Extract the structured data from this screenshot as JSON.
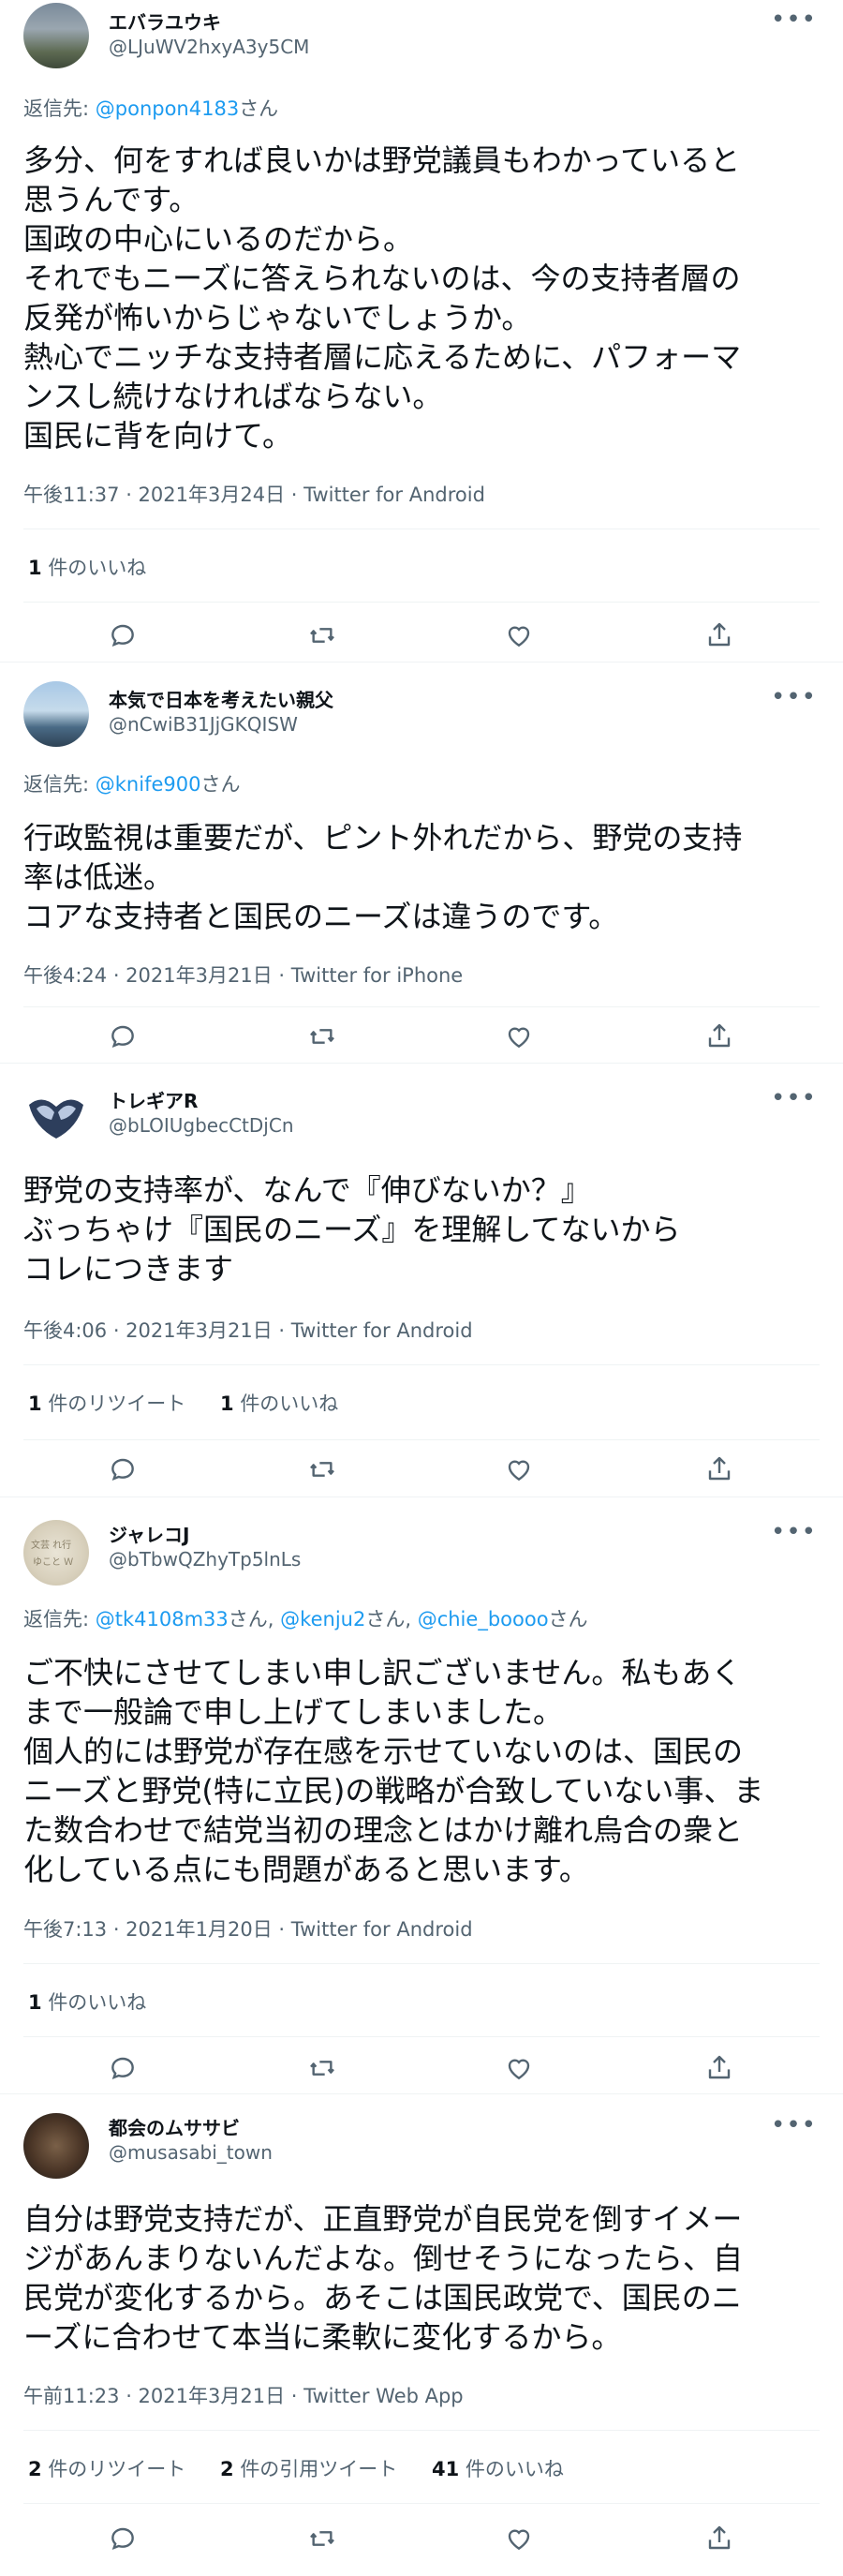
{
  "tweets": [
    {
      "name": "エバラユウキ",
      "handle": "@LJuWV2hxyA3y5CM",
      "reply_label": "返信先:",
      "reply_to": "@ponpon4183",
      "reply_suffix": "さん",
      "lines": [
        "多分、何をすれば良いかは野党議員もわかっていると",
        "思うんです。",
        "国政の中心にいるのだから。",
        "それでもニーズに答えられないのは、今の支持者層の",
        "反発が怖いからじゃないでしょうか。",
        "熱心でニッチな支持者層に応えるために、パフォーマ",
        "ンスし続けなければならない。",
        "国民に背を向けて。"
      ],
      "meta": "午後11:37 · 2021年3月24日 · Twitter for Android",
      "stats": [
        {
          "count": "1",
          "label": "件のいいね"
        }
      ]
    },
    {
      "name": "本気で日本を考えたい親父",
      "handle": "@nCwiB31JjGKQISW",
      "reply_label": "返信先:",
      "reply_to": "@knife900",
      "reply_suffix": "さん",
      "lines": [
        "行政監視は重要だが、ピント外れだから、野党の支持",
        "率は低迷。",
        "コアな支持者と国民のニーズは違うのです。"
      ],
      "meta": "午後4:24 · 2021年3月21日 · Twitter for iPhone",
      "stats": []
    },
    {
      "name": "トレギアR",
      "handle": "@bLOIUgbecCtDjCn",
      "lines": [
        "野党の支持率が、なんで『伸びないか？』",
        "ぶっちゃけ『国民のニーズ』を理解してないから",
        "コレにつきます"
      ],
      "meta": "午後4:06 · 2021年3月21日 · Twitter for Android",
      "stats": [
        {
          "count": "1",
          "label": "件のリツイート"
        },
        {
          "count": "1",
          "label": "件のいいね"
        }
      ]
    },
    {
      "name": "ジャレコJ",
      "handle": "@bTbwQZhyTp5lnLs",
      "reply_label": "返信先:",
      "reply_to_multi": [
        "@tk4108m33",
        "@kenju2",
        "@chie_boooo"
      ],
      "reply_sep": "さん,",
      "reply_suffix": "さん",
      "lines": [
        "ご不快にさせてしまい申し訳ございません。私もあく",
        "まで一般論で申し上げてしまいました。",
        "個人的には野党が存在感を示せていないのは、国民の",
        "ニーズと野党(特に立民)の戦略が合致していない事、ま",
        "た数合わせで結党当初の理念とはかけ離れ烏合の衆と",
        "化している点にも問題があると思います。"
      ],
      "meta": "午後7:13 · 2021年1月20日 · Twitter for Android",
      "stats": [
        {
          "count": "1",
          "label": "件のいいね"
        }
      ]
    },
    {
      "name": "都会のムササビ",
      "handle": "@musasabi_town",
      "lines": [
        "自分は野党支持だが、正直野党が自民党を倒すイメー",
        "ジがあんまりないんだよな。倒せそうになったら、自",
        "民党が変化するから。あそこは国民政党で、国民のニ",
        "ーズに合わせて本当に柔軟に変化するから。"
      ],
      "meta": "午前11:23 · 2021年3月21日 · Twitter Web App",
      "stats": [
        {
          "count": "2",
          "label": "件のリツイート"
        },
        {
          "count": "2",
          "label": "件の引用ツイート"
        },
        {
          "count": "41",
          "label": "件のいいね"
        }
      ]
    }
  ],
  "more_glyph": "•••",
  "icons": [
    "reply-icon",
    "retweet-icon",
    "like-icon",
    "share-icon"
  ]
}
